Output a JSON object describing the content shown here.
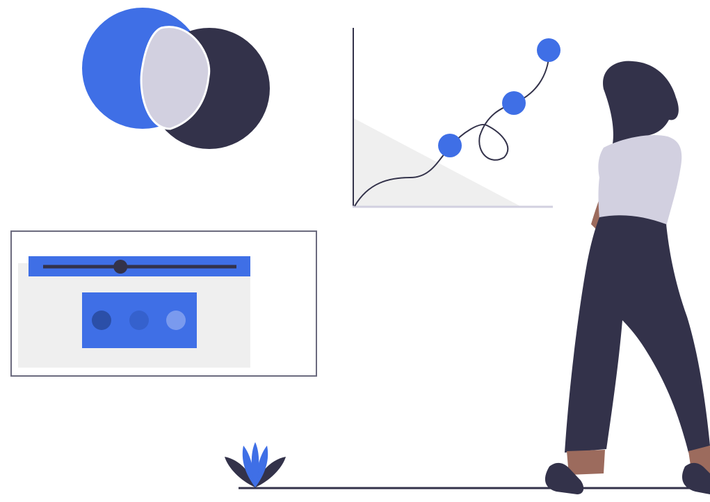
{
  "illustration": {
    "colors": {
      "accent_blue": "#3f6fe6",
      "dark_navy": "#33324a",
      "lavender": "#d2d0e0",
      "light_gray": "#efefef",
      "frame_gray": "#6b6a7e",
      "skin_brown": "#9c6b5d",
      "white": "#ffffff"
    },
    "icons": {
      "venn": "venn-diagram-icon",
      "chart": "line-chart-icon",
      "slider_panel": "slider-panel-icon",
      "plant": "plant-icon",
      "person": "person-icon"
    },
    "slider": {
      "level": 0.4
    },
    "carousel": {
      "dot_count": 3,
      "active_index": 0
    }
  }
}
